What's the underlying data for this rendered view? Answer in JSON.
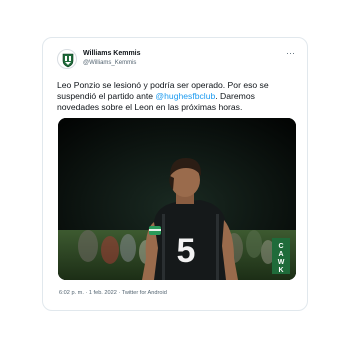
{
  "tweet": {
    "author_name": "Williams Kemmis",
    "author_handle": "@Williams_Kemmis",
    "more_glyph": "···",
    "text_before_mention": "Leo Ponzio se lesionó y podría ser operado. Por eso se suspendió el partido ante ",
    "mention": "@hughesfbclub",
    "text_after_mention": ". Daremos novedades sobre el Leon en las próximas horas.",
    "time": "6:02 p. m.",
    "separator": " · ",
    "date": "1 feb. 2022",
    "source": "Twitter for Android",
    "jersey_number": "5",
    "club_badge_letters": [
      "C",
      "A",
      "W",
      "K"
    ]
  },
  "colors": {
    "link": "#1d9bf0",
    "text": "#0f1419",
    "secondary": "#536471",
    "border": "#e1e8ed",
    "club_green": "#1f6b3a"
  },
  "icons": {
    "avatar": "club-crest-icon",
    "more": "more-options-icon"
  }
}
